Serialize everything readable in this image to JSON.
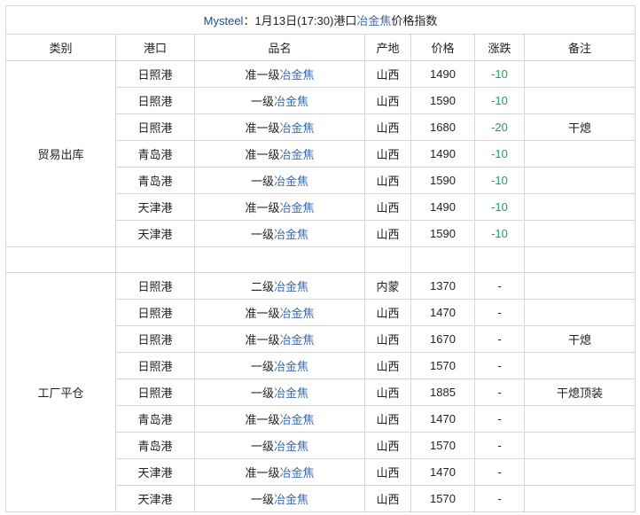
{
  "title": {
    "brand": "Mysteel",
    "mid": "：1月13日(17:30)港口",
    "link": "冶金焦",
    "tail": "价格指数"
  },
  "headers": [
    "类别",
    "港口",
    "品名",
    "产地",
    "价格",
    "涨跌",
    "备注"
  ],
  "sections": [
    {
      "category": "贸易出库",
      "rows": [
        {
          "port": "日照港",
          "grade": "准一级",
          "product": "冶金焦",
          "origin": "山西",
          "price": "1490",
          "change": "-10",
          "note": ""
        },
        {
          "port": "日照港",
          "grade": "一级",
          "product": "冶金焦",
          "origin": "山西",
          "price": "1590",
          "change": "-10",
          "note": ""
        },
        {
          "port": "日照港",
          "grade": "准一级",
          "product": "冶金焦",
          "origin": "山西",
          "price": "1680",
          "change": "-20",
          "note": "干熄"
        },
        {
          "port": "青岛港",
          "grade": "准一级",
          "product": "冶金焦",
          "origin": "山西",
          "price": "1490",
          "change": "-10",
          "note": ""
        },
        {
          "port": "青岛港",
          "grade": "一级",
          "product": "冶金焦",
          "origin": "山西",
          "price": "1590",
          "change": "-10",
          "note": ""
        },
        {
          "port": "天津港",
          "grade": "准一级",
          "product": "冶金焦",
          "origin": "山西",
          "price": "1490",
          "change": "-10",
          "note": ""
        },
        {
          "port": "天津港",
          "grade": "一级",
          "product": "冶金焦",
          "origin": "山西",
          "price": "1590",
          "change": "-10",
          "note": ""
        }
      ]
    },
    {
      "category": "工厂平仓",
      "rows": [
        {
          "port": "日照港",
          "grade": "二级",
          "product": "冶金焦",
          "origin": "内蒙",
          "price": "1370",
          "change": "-",
          "note": ""
        },
        {
          "port": "日照港",
          "grade": "准一级",
          "product": "冶金焦",
          "origin": "山西",
          "price": "1470",
          "change": "-",
          "note": ""
        },
        {
          "port": "日照港",
          "grade": "准一级",
          "product": "冶金焦",
          "origin": "山西",
          "price": "1670",
          "change": "-",
          "note": "干熄"
        },
        {
          "port": "日照港",
          "grade": "一级",
          "product": "冶金焦",
          "origin": "山西",
          "price": "1570",
          "change": "-",
          "note": ""
        },
        {
          "port": "日照港",
          "grade": "一级",
          "product": "冶金焦",
          "origin": "山西",
          "price": "1885",
          "change": "-",
          "note": "干熄顶装"
        },
        {
          "port": "青岛港",
          "grade": "准一级",
          "product": "冶金焦",
          "origin": "山西",
          "price": "1470",
          "change": "-",
          "note": ""
        },
        {
          "port": "青岛港",
          "grade": "一级",
          "product": "冶金焦",
          "origin": "山西",
          "price": "1570",
          "change": "-",
          "note": ""
        },
        {
          "port": "天津港",
          "grade": "准一级",
          "product": "冶金焦",
          "origin": "山西",
          "price": "1470",
          "change": "-",
          "note": ""
        },
        {
          "port": "天津港",
          "grade": "一级",
          "product": "冶金焦",
          "origin": "山西",
          "price": "1570",
          "change": "-",
          "note": ""
        }
      ]
    }
  ],
  "colors": {
    "link": "#3b6aa8",
    "down": "#1aa35a",
    "border": "#d6d6d6"
  }
}
